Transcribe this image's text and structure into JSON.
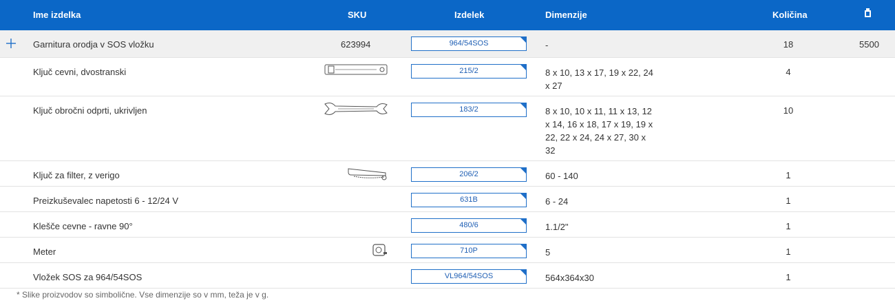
{
  "header": {
    "name": "Ime izdelka",
    "sku": "SKU",
    "product": "Izdelek",
    "dimensions": "Dimenzije",
    "quantity": "Količina",
    "weight_icon": "weight-icon"
  },
  "rows": [
    {
      "name": "Garnitura orodja v SOS vložku",
      "sku": "623994",
      "product": "964/54SOS",
      "dim": "-",
      "qty": "18",
      "weight": "5500",
      "icon": "plus-icon"
    },
    {
      "name": "Ključ cevni, dvostranski",
      "sku": "",
      "product": "215/2",
      "dim": "8 x 10, 13 x 17, 19 x 22, 24 x 27",
      "qty": "4",
      "weight": "",
      "icon": "tube-wrench-icon"
    },
    {
      "name": "Ključ obročni odprti, ukrivljen",
      "sku": "",
      "product": "183/2",
      "dim": "8 x 10, 10 x 11, 11 x 13, 12 x 14, 16 x 18, 17 x 19, 19 x 22, 22 x 24, 24 x 27, 30 x 32",
      "qty": "10",
      "weight": "",
      "icon": "flare-wrench-icon"
    },
    {
      "name": "Ključ za filter, z verigo",
      "sku": "",
      "product": "206/2",
      "dim": "60 - 140",
      "qty": "1",
      "weight": "",
      "icon": "chain-filter-wrench-icon"
    },
    {
      "name": "Preizkuševalec napetosti 6 - 12/24 V",
      "sku": "",
      "product": "631B",
      "dim": "6 - 24",
      "qty": "1",
      "weight": "",
      "icon": ""
    },
    {
      "name": "Klešče cevne - ravne 90°",
      "sku": "",
      "product": "480/6",
      "dim": "1.1/2\"",
      "qty": "1",
      "weight": "",
      "icon": ""
    },
    {
      "name": "Meter",
      "sku": "",
      "product": "710P",
      "dim": "5",
      "qty": "1",
      "weight": "",
      "icon": "tape-measure-icon"
    },
    {
      "name": "Vložek SOS za 964/54SOS",
      "sku": "",
      "product": "VL964/54SOS",
      "dim": "564x364x30",
      "qty": "1",
      "weight": "",
      "icon": ""
    }
  ],
  "footnote": "* Slike proizvodov so simbolične. Vse dimenzije so v mm, teža je v g.",
  "colors": {
    "header_bg": "#0b67c7",
    "link": "#1f6fc8"
  }
}
